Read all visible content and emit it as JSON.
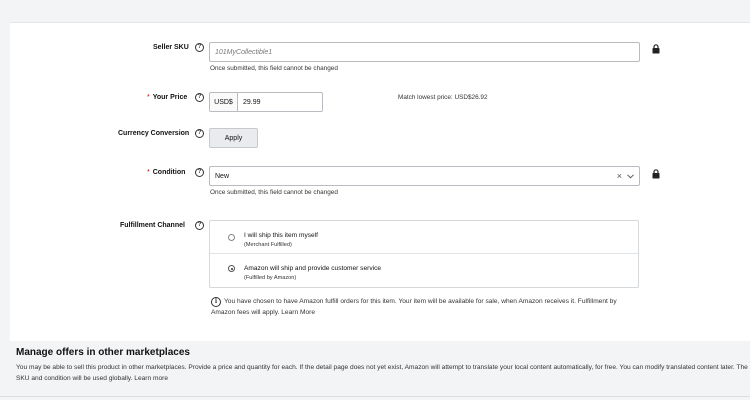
{
  "form": {
    "seller_sku": {
      "label": "Seller SKU",
      "help": "?",
      "placeholder": "101MyCollectible1",
      "hint": "Once submitted, this field cannot be changed"
    },
    "your_price": {
      "required_mark": "*",
      "label": "Your Price",
      "help": "?",
      "currency": "USD$",
      "value": "29.99",
      "match_lowest": "Match lowest price: USD$26.92"
    },
    "currency_conversion": {
      "label": "Currency Conversion",
      "help": "?",
      "apply_label": "Apply"
    },
    "condition": {
      "required_mark": "*",
      "label": "Condition",
      "help": "?",
      "value": "New",
      "clear_glyph": "×",
      "hint": "Once submitted, this field cannot be changed"
    },
    "fulfillment_channel": {
      "label": "Fulfillment Channel",
      "help": "?",
      "options": [
        {
          "title": "I will ship this item myself",
          "subtitle": "(Merchant Fulfilled)",
          "selected": false
        },
        {
          "title": "Amazon will ship and provide customer service",
          "subtitle": "(Fulfilled by Amazon)",
          "selected": true
        }
      ],
      "info_icon": "i",
      "info_text": "You have chosen to have Amazon fulfill orders for this item. Your item will be available for sale, when Amazon receives it. Fulfillment by Amazon fees will apply.",
      "info_link": "Learn More"
    }
  },
  "marketplaces": {
    "title": "Manage offers in other marketplaces",
    "text": "You may be able to sell this product in other marketplaces. Provide a price and quantity for each. If the detail page does not yet exist, Amazon will attempt to translate your local content automatically, for free. You can modify translated content later. The same SKU and condition will be used globally.",
    "link": "Learn more"
  },
  "icons": {
    "lock": "lock-icon",
    "help": "question-circle-icon",
    "chevron": "chevron-down-icon",
    "info": "info-circle-icon"
  },
  "colors": {
    "required": "#c40000",
    "page_bg": "#f3f4f5",
    "button_bg": "#e9ebee"
  }
}
